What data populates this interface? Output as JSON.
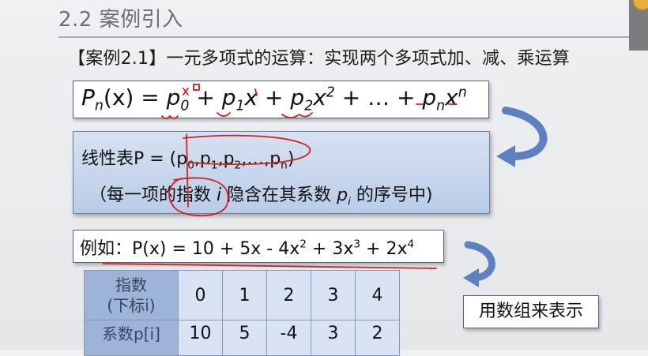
{
  "slide": {
    "title": "2.2 案例引入",
    "case_heading": "【案例2.1】一元多项式的运算：实现两个多项式加、减、乘运算",
    "polynomial": {
      "lhs": "P",
      "lhs_sub": "n",
      "lhs_arg": "(x)",
      "eq": " = ",
      "t0": "p",
      "t0_sub": "0",
      "plus1": " + ",
      "t1": "p",
      "t1_sub": "1",
      "t1_x": "x",
      "plus2": " + ",
      "t2": "p",
      "t2_sub": "2",
      "t2_x": "x",
      "t2_sup": "2",
      "dots": " + … + ",
      "tn": "p",
      "tn_sub": "n",
      "tn_x": "x",
      "tn_sup": "n"
    },
    "linear_table": {
      "label": "线性表P = (",
      "p": "p",
      "s0": "0",
      "s1": "1",
      "s2": "2",
      "ellipsis": ",…,",
      "sn": "n",
      "close": ")",
      "note_a": "（每一项的指数 ",
      "note_i": "i",
      "note_b": " 隐含在其系数 ",
      "note_p": "p",
      "note_pi": "i",
      "note_c": " 的序号中)"
    },
    "example": {
      "prefix": "例如：P(x) = 10 + 5x - 4x",
      "e2": "2",
      "mid1": " + 3x",
      "e3": "3",
      "mid2": " + 2x",
      "e4": "4"
    },
    "array_table": {
      "row1_header_line1": "指数",
      "row1_header_line2": "(下标i)",
      "row1_values": [
        "0",
        "1",
        "2",
        "3",
        "4"
      ],
      "row2_header": "系数p[i]",
      "row2_values": [
        "10",
        "5",
        "-4",
        "3",
        "2"
      ]
    },
    "array_note": "用数组来表示"
  },
  "colors": {
    "table_header": "#9db3d8",
    "table_cell": "#d9e3f3",
    "linear_box": "#b9cce7",
    "annotation_red": "#d42020",
    "arrow_blue": "#5f7fc0"
  }
}
